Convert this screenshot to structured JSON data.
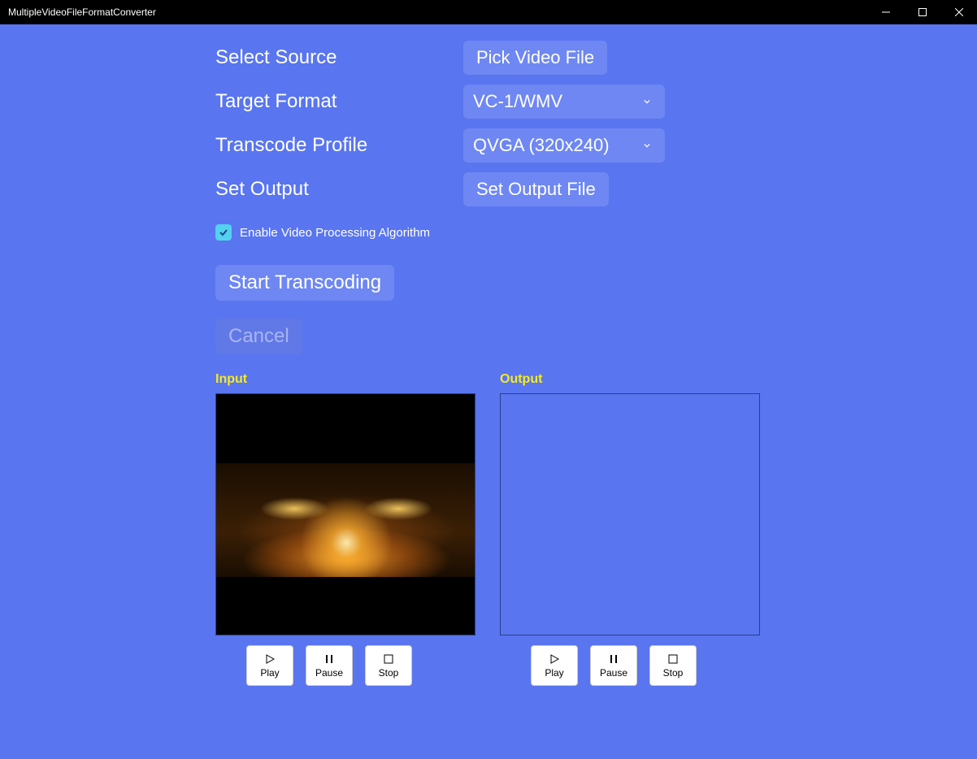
{
  "window": {
    "title": "MultipleVideoFileFormatConverter"
  },
  "form": {
    "selectSource": {
      "label": "Select Source",
      "button": "Pick Video File"
    },
    "targetFormat": {
      "label": "Target Format",
      "value": "VC-1/WMV"
    },
    "transcodeProfile": {
      "label": "Transcode Profile",
      "value": "QVGA (320x240)"
    },
    "setOutput": {
      "label": "Set Output",
      "button": "Set Output File"
    }
  },
  "checkbox": {
    "label": "Enable Video Processing Algorithm",
    "checked": true
  },
  "actions": {
    "start": "Start Transcoding",
    "cancel": "Cancel"
  },
  "preview": {
    "input": {
      "label": "Input"
    },
    "output": {
      "label": "Output"
    },
    "controls": {
      "play": "Play",
      "pause": "Pause",
      "stop": "Stop"
    }
  }
}
